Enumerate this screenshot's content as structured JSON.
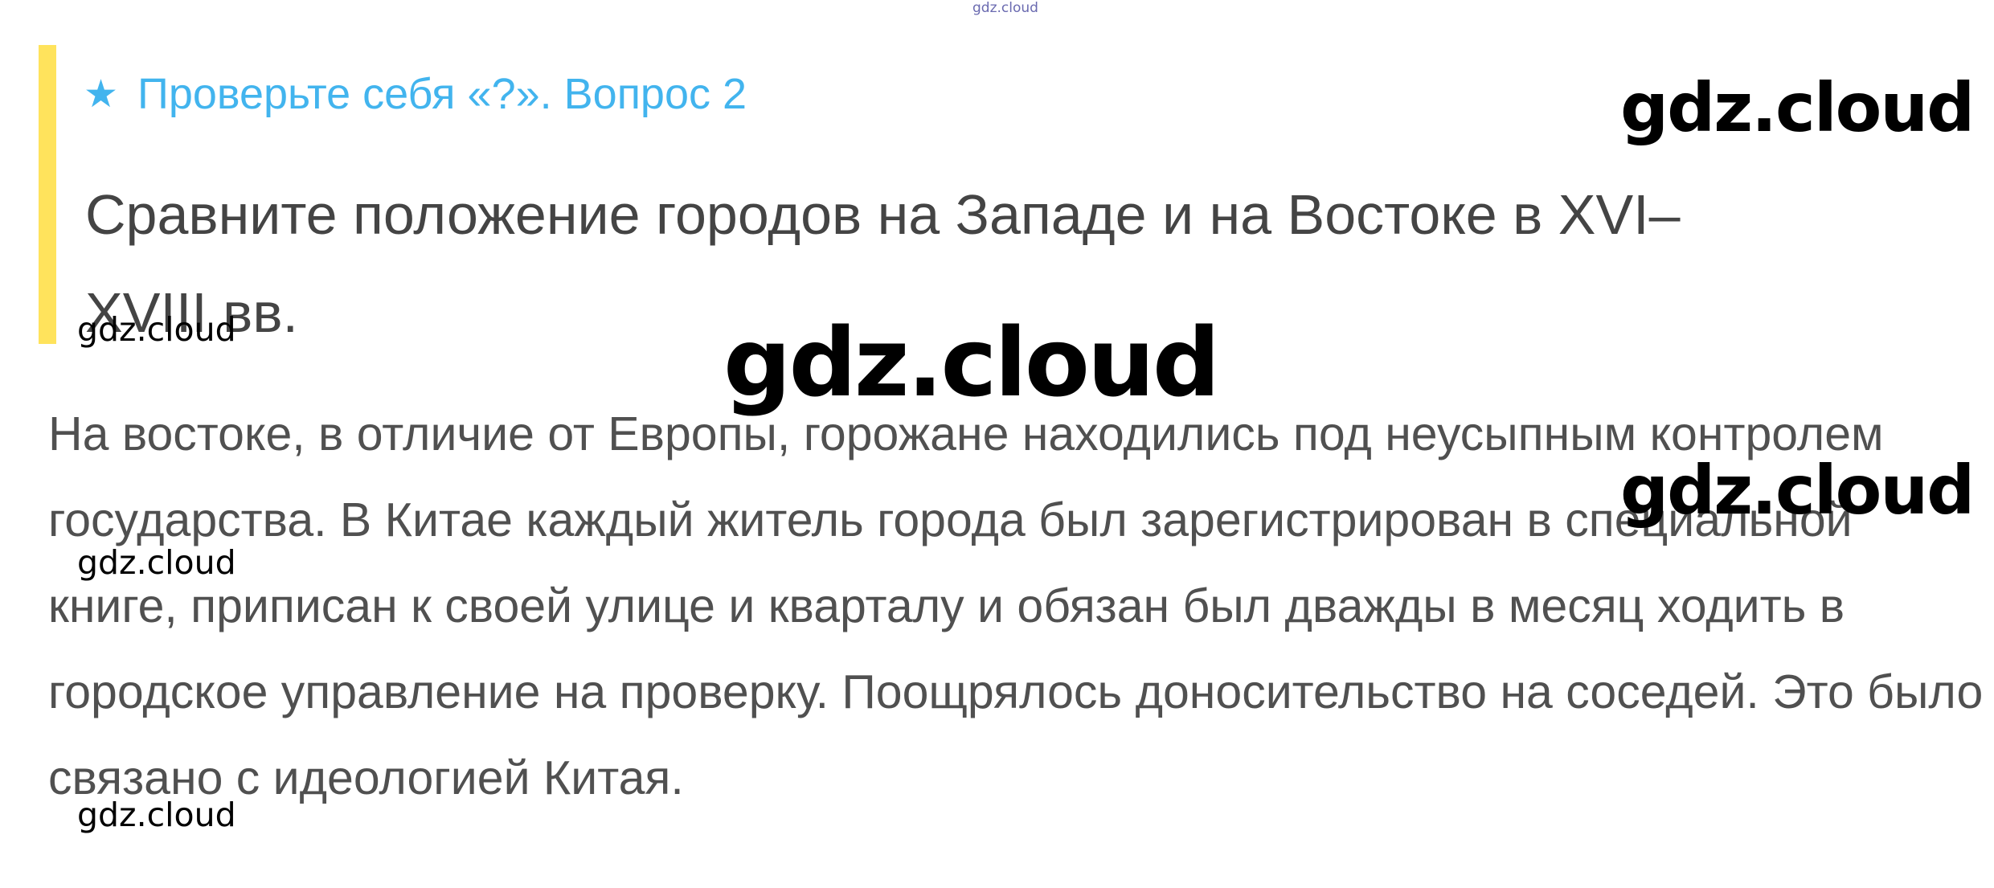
{
  "watermark": {
    "text": "gdz.cloud"
  },
  "question": {
    "icon": "star-icon",
    "star_glyph": "★",
    "title": "Проверьте себя «?». Вопрос 2",
    "text": "Сравните положение городов на Западе и на Востоке в XVI–XVIII вв."
  },
  "answer": {
    "text": "На востоке, в отличие от Европы, горожане находились под неусыпным контролем государства. В Китае каждый житель города был зарегистрирован в специальной книге, приписан к своей улице и кварталу и обязан был дважды в месяц ходить в городское управление на проверку. Поощрялось доносительство на соседей. Это было связано с идеологией Китая."
  },
  "colors": {
    "accent_bar": "#ffe35c",
    "title": "#42b4ee",
    "body_text": "#444444"
  }
}
